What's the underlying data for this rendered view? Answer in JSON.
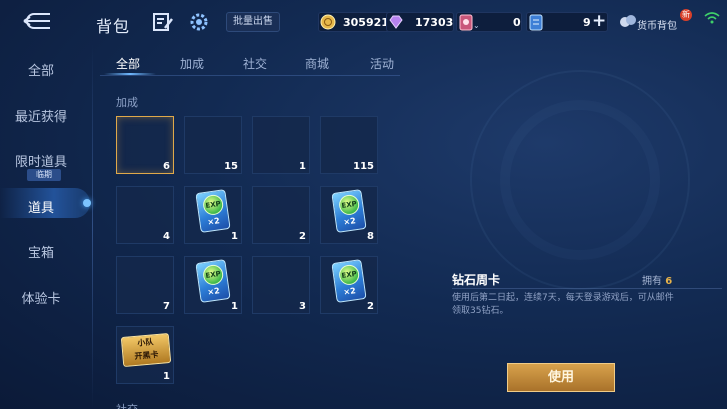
{
  "header": {
    "title": "背包",
    "batch_sell_label": "批量出售",
    "gold": "305921",
    "diamond": "17303",
    "card_a_count": "0",
    "card_b_count": "9",
    "currency_bag_label": "货币背包",
    "new_badge": "新"
  },
  "sidebar": {
    "items": [
      {
        "label": "全部"
      },
      {
        "label": "最近获得"
      },
      {
        "label": "限时道具",
        "tag": "临期"
      },
      {
        "label": "道具"
      },
      {
        "label": "宝箱"
      },
      {
        "label": "体验卡"
      }
    ],
    "active_index": 3
  },
  "tabs": [
    "全部",
    "加成",
    "社交",
    "商城",
    "活动"
  ],
  "active_tab": "全部",
  "sections": {
    "boost": "加成",
    "social": "社交"
  },
  "grid": [
    {
      "count": "6",
      "icon": "empty",
      "selected": true
    },
    {
      "count": "15",
      "icon": "empty"
    },
    {
      "count": "1",
      "icon": "empty"
    },
    {
      "count": "115",
      "icon": "empty"
    },
    {
      "count": "4",
      "icon": "empty"
    },
    {
      "count": "1",
      "icon": "exp-card"
    },
    {
      "count": "2",
      "icon": "empty"
    },
    {
      "count": "8",
      "icon": "exp-card"
    },
    {
      "count": "7",
      "icon": "empty"
    },
    {
      "count": "1",
      "icon": "exp-card"
    },
    {
      "count": "3",
      "icon": "empty"
    },
    {
      "count": "2",
      "icon": "exp-card"
    },
    {
      "count": "1",
      "icon": "team-card"
    }
  ],
  "icon_text": {
    "exp": "EXP",
    "x2": "×2",
    "team_line1": "小队",
    "team_line2": "开黑卡"
  },
  "detail": {
    "name": "钻石周卡",
    "owned_label": "拥有",
    "owned_count": "6",
    "description": "使用后第二日起，连续7天，每天登录游戏后，可从邮件领取35钻石。",
    "use_label": "使用"
  },
  "colors": {
    "accent_gold": "#e8b34a",
    "button_gold": "#d8a24c",
    "active_blue": "#6fb8ff"
  }
}
